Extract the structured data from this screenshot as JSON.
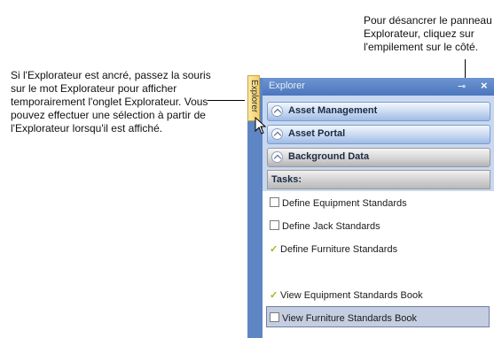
{
  "callouts": {
    "left": "Si l'Explorateur est ancré, passez la souris sur le mot Explorateur pour afficher temporairement l'onglet Explorateur. Vous pouvez effectuer une sélection à partir de l'Explorateur lorsqu'il est affiché.",
    "right": "Pour désancrer le panneau Explorateur, cliquez sur l'empilement sur le côté."
  },
  "tab": {
    "label": "Explorer"
  },
  "panel": {
    "title": "Explorer",
    "pin_icon": "pin-icon",
    "close_icon": "close-icon"
  },
  "groups": [
    {
      "label": "Asset Management"
    },
    {
      "label": "Asset Portal"
    },
    {
      "label": "Background Data"
    }
  ],
  "tasks_header": "Tasks:",
  "tasks": [
    {
      "label": "Define Equipment Standards",
      "state": "unchecked"
    },
    {
      "label": "Define Jack Standards",
      "state": "unchecked"
    },
    {
      "label": "Define Furniture Standards",
      "state": "checked"
    },
    {
      "label": "View Equipment Standards Book",
      "state": "checked"
    },
    {
      "label": "View Furniture Standards Book",
      "state": "unchecked"
    }
  ]
}
